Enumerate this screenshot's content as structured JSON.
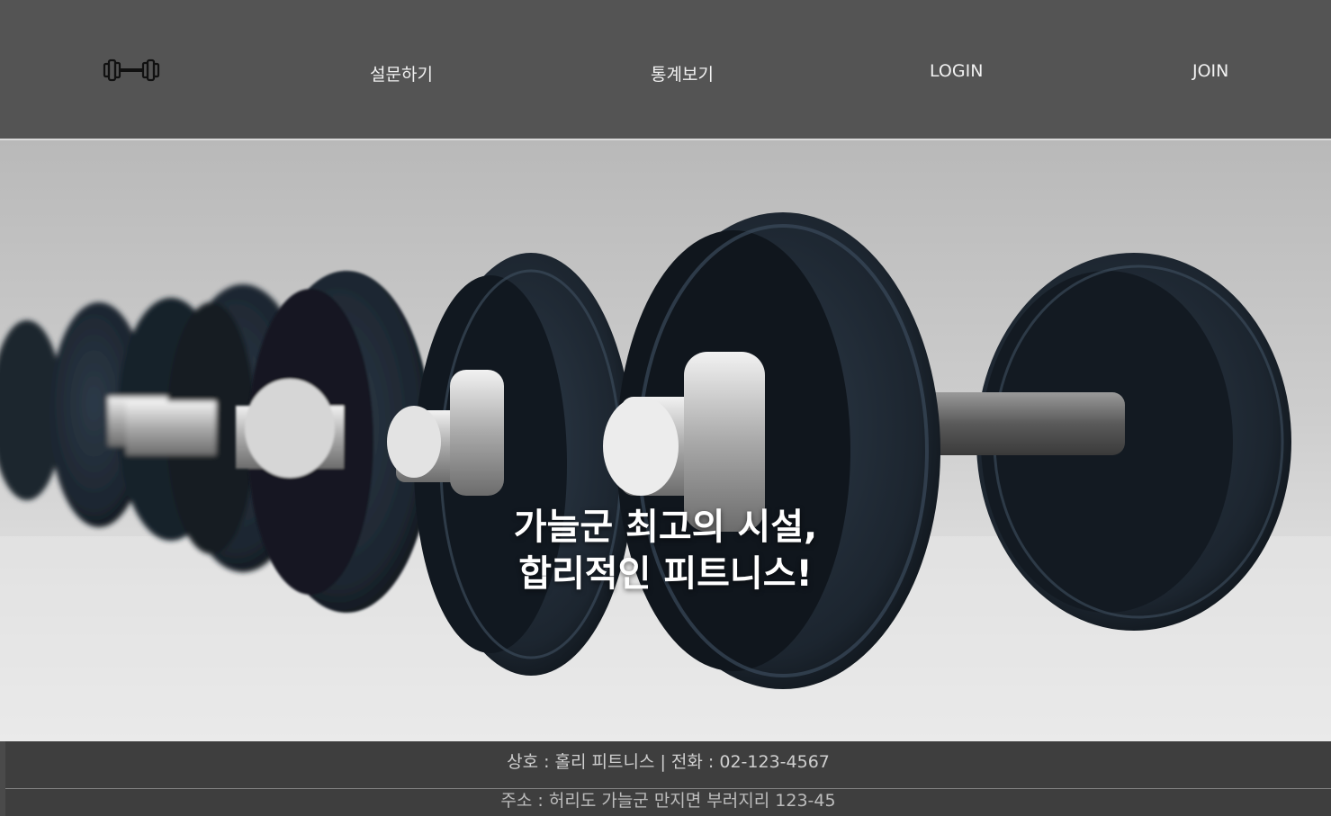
{
  "header": {
    "logo_icon": "dumbbell-icon",
    "nav": [
      {
        "label": "설문하기"
      },
      {
        "label": "통계보기"
      },
      {
        "label": "LOGIN"
      },
      {
        "label": "JOIN"
      }
    ]
  },
  "hero": {
    "image": "dumbbell-rack-photo",
    "headline_line1": "가늘군 최고의 시설,",
    "headline_line2": "합리적인 피트니스!"
  },
  "footer": {
    "line1": "상호 : 홀리 피트니스 | 전화 : 02-123-4567",
    "line2": "주소 : 허리도 가늘군 만지면 부러지리 123-45"
  },
  "colors": {
    "header_bg": "#545454",
    "footer_bg": "#3e3e3e",
    "text": "#ffffff"
  }
}
